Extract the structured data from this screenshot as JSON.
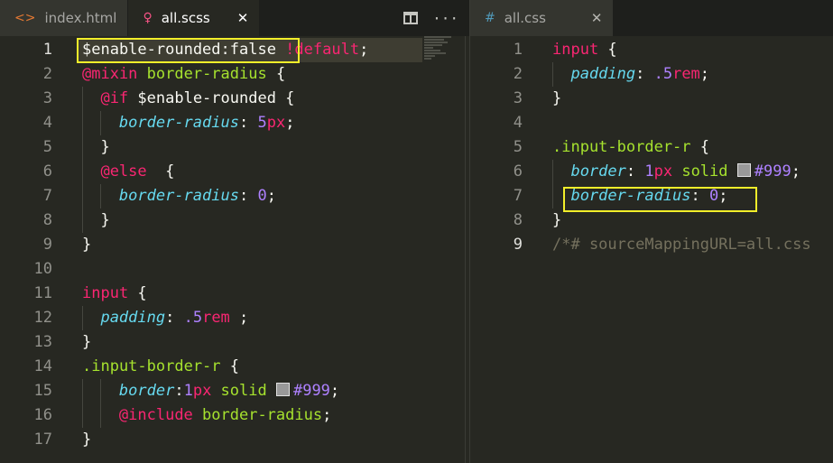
{
  "left_pane": {
    "tabs": [
      {
        "label": "index.html",
        "icon": "code-icon",
        "active": false
      },
      {
        "label": "all.scss",
        "icon": "sass-icon",
        "active": true,
        "close": "✕"
      }
    ],
    "actions": {
      "split": "split-editor-icon",
      "more": "···"
    },
    "line_numbers": [
      "1",
      "2",
      "3",
      "4",
      "5",
      "6",
      "7",
      "8",
      "9",
      "10",
      "11",
      "12",
      "13",
      "14",
      "15",
      "16",
      "17"
    ],
    "lines": [
      {
        "tokens": [
          {
            "t": "$enable-rounded:false ",
            "c": "var"
          },
          {
            "t": "!default",
            "c": "kw"
          },
          {
            "t": ";",
            "c": "pun"
          }
        ]
      },
      {
        "tokens": [
          {
            "t": "@mixin ",
            "c": "kw"
          },
          {
            "t": "border-radius ",
            "c": "sel"
          },
          {
            "t": "{",
            "c": "pun"
          }
        ]
      },
      {
        "tokens": [
          {
            "t": "@if ",
            "c": "kw"
          },
          {
            "t": "$enable-rounded ",
            "c": "var"
          },
          {
            "t": "{",
            "c": "pun"
          }
        ]
      },
      {
        "tokens": [
          {
            "t": "border-radius",
            "c": "prop"
          },
          {
            "t": ": ",
            "c": "pun"
          },
          {
            "t": "5",
            "c": "num"
          },
          {
            "t": "px",
            "c": "unit"
          },
          {
            "t": ";",
            "c": "pun"
          }
        ]
      },
      {
        "tokens": [
          {
            "t": "}",
            "c": "pun"
          }
        ]
      },
      {
        "tokens": [
          {
            "t": "@else  ",
            "c": "kw"
          },
          {
            "t": "{",
            "c": "pun"
          }
        ]
      },
      {
        "tokens": [
          {
            "t": "border-radius",
            "c": "prop"
          },
          {
            "t": ": ",
            "c": "pun"
          },
          {
            "t": "0",
            "c": "num"
          },
          {
            "t": ";",
            "c": "pun"
          }
        ]
      },
      {
        "tokens": [
          {
            "t": "}",
            "c": "pun"
          }
        ]
      },
      {
        "tokens": [
          {
            "t": "}",
            "c": "pun"
          }
        ]
      },
      {
        "tokens": []
      },
      {
        "tokens": [
          {
            "t": "input ",
            "c": "kw"
          },
          {
            "t": "{",
            "c": "pun"
          }
        ]
      },
      {
        "tokens": [
          {
            "t": "padding",
            "c": "prop"
          },
          {
            "t": ": ",
            "c": "pun"
          },
          {
            "t": ".5",
            "c": "num"
          },
          {
            "t": "rem",
            "c": "unit"
          },
          {
            "t": " ;",
            "c": "pun"
          }
        ]
      },
      {
        "tokens": [
          {
            "t": "}",
            "c": "pun"
          }
        ]
      },
      {
        "tokens": [
          {
            "t": ".input-border-r ",
            "c": "sel"
          },
          {
            "t": "{",
            "c": "pun"
          }
        ]
      },
      {
        "tokens": [
          {
            "t": "border",
            "c": "prop"
          },
          {
            "t": ":",
            "c": "pun"
          },
          {
            "t": "1",
            "c": "num"
          },
          {
            "t": "px",
            "c": "unit"
          },
          {
            "t": " solid ",
            "c": "sel"
          },
          {
            "t": "",
            "c": "swatch"
          },
          {
            "t": "#999",
            "c": "num"
          },
          {
            "t": ";",
            "c": "pun"
          }
        ]
      },
      {
        "tokens": [
          {
            "t": "@include ",
            "c": "kw"
          },
          {
            "t": "border-radius",
            "c": "sel"
          },
          {
            "t": ";",
            "c": "pun"
          }
        ]
      },
      {
        "tokens": [
          {
            "t": "}",
            "c": "pun"
          }
        ]
      }
    ]
  },
  "right_pane": {
    "tabs": [
      {
        "label": "all.css",
        "icon": "hash-icon",
        "active": false,
        "close": "✕"
      }
    ],
    "line_numbers": [
      "1",
      "2",
      "3",
      "4",
      "5",
      "6",
      "7",
      "8",
      "9"
    ],
    "lines": [
      {
        "tokens": [
          {
            "t": "input ",
            "c": "kw"
          },
          {
            "t": "{",
            "c": "pun"
          }
        ]
      },
      {
        "tokens": [
          {
            "t": "padding",
            "c": "prop"
          },
          {
            "t": ": ",
            "c": "pun"
          },
          {
            "t": ".5",
            "c": "num"
          },
          {
            "t": "rem",
            "c": "unit"
          },
          {
            "t": ";",
            "c": "pun"
          }
        ]
      },
      {
        "tokens": [
          {
            "t": "}",
            "c": "pun"
          }
        ]
      },
      {
        "tokens": []
      },
      {
        "tokens": [
          {
            "t": ".input-border-r ",
            "c": "sel"
          },
          {
            "t": "{",
            "c": "pun"
          }
        ]
      },
      {
        "tokens": [
          {
            "t": "border",
            "c": "prop"
          },
          {
            "t": ": ",
            "c": "pun"
          },
          {
            "t": "1",
            "c": "num"
          },
          {
            "t": "px",
            "c": "unit"
          },
          {
            "t": " solid ",
            "c": "sel"
          },
          {
            "t": "",
            "c": "swatch"
          },
          {
            "t": "#999",
            "c": "num"
          },
          {
            "t": ";",
            "c": "pun"
          }
        ]
      },
      {
        "tokens": [
          {
            "t": "border-radius",
            "c": "prop"
          },
          {
            "t": ": ",
            "c": "pun"
          },
          {
            "t": "0",
            "c": "num"
          },
          {
            "t": ";",
            "c": "pun"
          }
        ]
      },
      {
        "tokens": [
          {
            "t": "}",
            "c": "pun"
          }
        ]
      },
      {
        "tokens": [
          {
            "t": "/*# sourceMappingURL=all.css",
            "c": "com"
          }
        ]
      }
    ]
  },
  "colors": {
    "highlight_box": "#f2ee2a",
    "editor_bg": "#272822",
    "swatch": "#999999"
  }
}
